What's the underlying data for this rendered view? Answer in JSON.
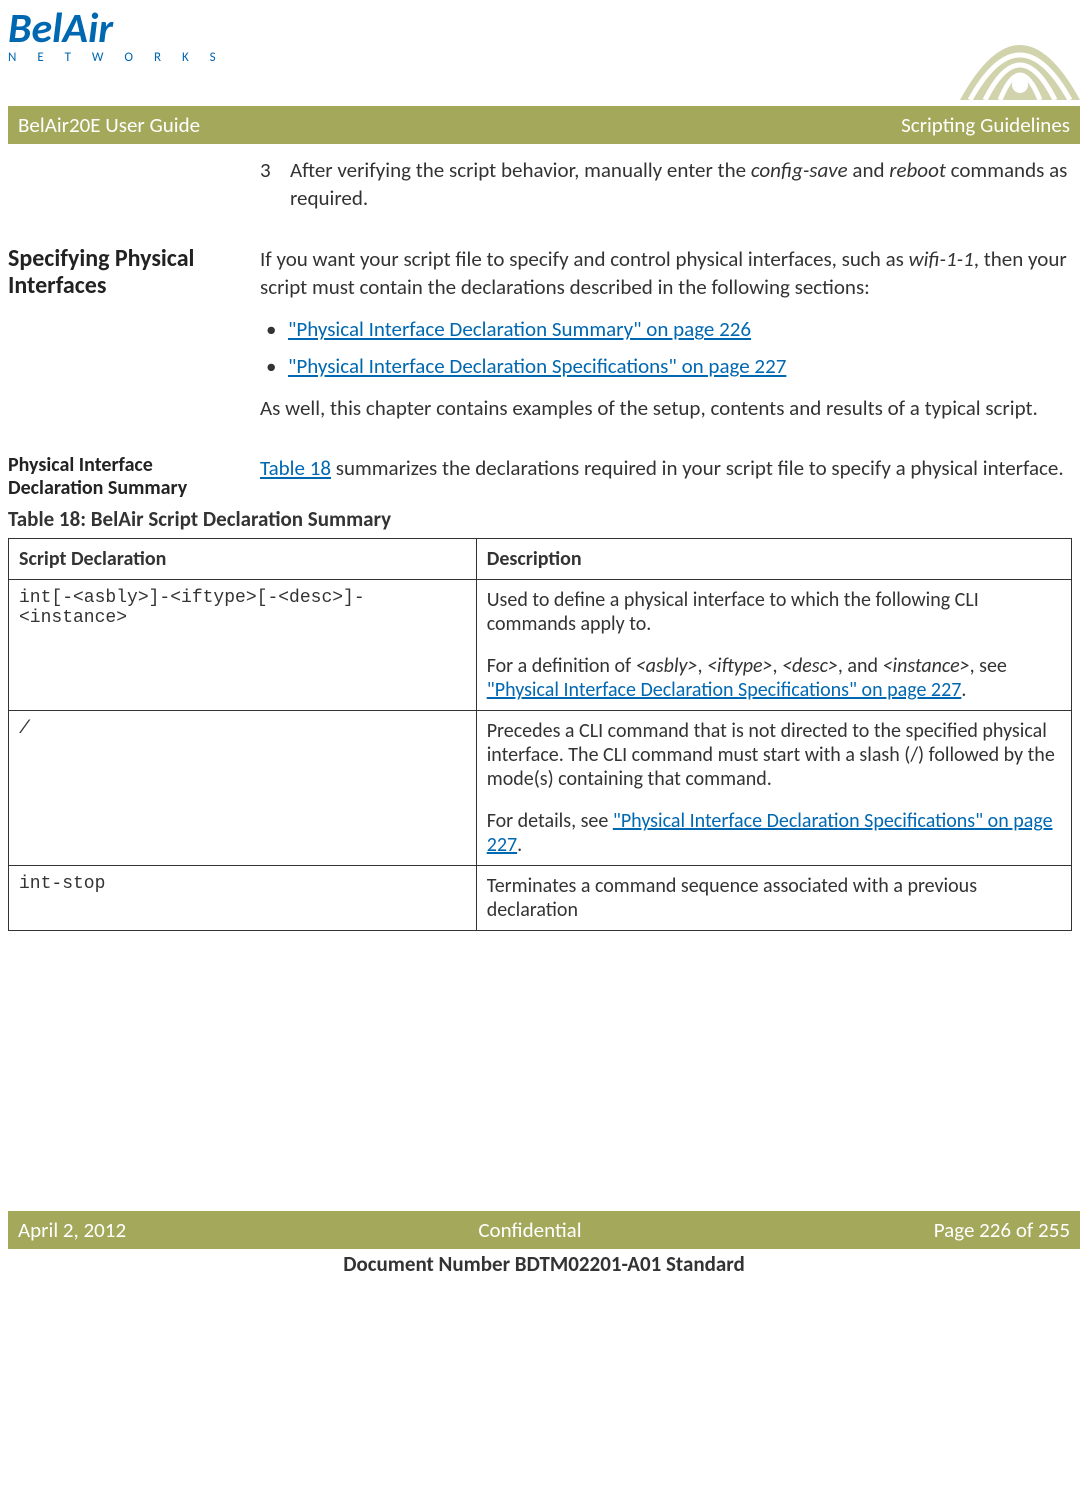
{
  "header": {
    "logo_main": "BelAir",
    "logo_sub": "N E T W O R K S",
    "banner_left": "BelAir20E User Guide",
    "banner_right": "Scripting Guidelines"
  },
  "step3": {
    "num": "3",
    "before": "After verifying the script behavior, manually enter the ",
    "cmd1": "config-save",
    "mid": " and ",
    "cmd2": "reboot",
    "after": " commands as required."
  },
  "spec_phys": {
    "heading": "Specifying Physical Interfaces",
    "intro_a": "If you want your script file to specify and control physical interfaces, such as ",
    "intro_ital": "wifi-1-1",
    "intro_b": ", then your script must contain the declarations described in the following sections:",
    "bullet1": "\"Physical Interface Declaration Summary\" on page 226",
    "bullet2": "\"Physical Interface Declaration Specifications\" on page 227",
    "closing": "As well, this chapter contains examples of the setup, contents and results of a typical script."
  },
  "decl_summary": {
    "heading": "Physical Interface Declaration Summary",
    "link": "Table 18",
    "rest": " summarizes the declarations required in your script file to specify a physical interface."
  },
  "table": {
    "caption": "Table 18: BelAir Script Declaration Summary",
    "col1": "Script Declaration",
    "col2": "Description",
    "row1": {
      "decl": "int[-<asbly>]-<iftype>[-<desc>]-<instance>",
      "desc_a": "Used to define a physical interface to which the following CLI commands apply to.",
      "desc_b1": "For a definition of ",
      "p1": "<asbly>",
      "c1": ", ",
      "p2": "<iftype>",
      "c2": ", ",
      "p3": "<desc>",
      "c3": ", and ",
      "p4": "<instance>",
      "c4": ", see ",
      "link": "\"Physical Interface Declaration Specifications\" on page 227",
      "end": "."
    },
    "row2": {
      "decl": "/",
      "desc_a": "Precedes a CLI command that is not directed to the specified physical interface. The CLI command must start with a slash (/) followed by the mode(s) containing that command.",
      "desc_b1": "For details, see ",
      "link": "\"Physical Interface Declaration Specifications\" on page 227",
      "end": "."
    },
    "row3": {
      "decl": "int-stop",
      "desc": "Terminates a command sequence associated with a previous declaration"
    }
  },
  "footer": {
    "left": "April 2, 2012",
    "center": "Confidential",
    "right": "Page 226 of 255",
    "docnum": "Document Number BDTM02201-A01 Standard"
  }
}
